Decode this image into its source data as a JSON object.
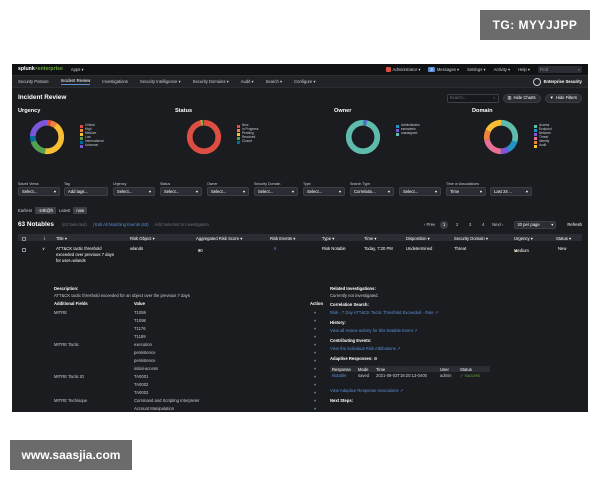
{
  "watermarks": {
    "top": "TG: MYYJJPP",
    "bottom": "www.saasjia.com"
  },
  "topbar": {
    "logo_main": "splunk",
    "logo_suffix": ">enterprise",
    "apps": "Apps ▾",
    "administrator": "Administrator ▾",
    "messages_count": "2",
    "messages": "Messages ▾",
    "settings": "Settings ▾",
    "activity": "Activity ▾",
    "help": "Help ▾",
    "find": "Find"
  },
  "nav": {
    "items": [
      "Security Posture",
      "Incident Review",
      "Investigations",
      "Security Intelligence ▾",
      "Security Domains ▾",
      "Audit ▾",
      "Search ▾",
      "Configure ▾"
    ],
    "brand": "Enterprise Security"
  },
  "header": {
    "title": "Incident Review",
    "search_placeholder": "Search...",
    "hide_charts": "Hide Charts",
    "hide_filters": "Hide Filters"
  },
  "charts": [
    {
      "title": "Urgency",
      "legend": [
        "Critical",
        "High",
        "Medium",
        "Low",
        "Informational",
        "Unknown"
      ],
      "colors": [
        "#dc4e41",
        "#f1813f",
        "#f8be34",
        "#53a051",
        "#006d9c",
        "#7b56db"
      ],
      "values": [
        4,
        6,
        42,
        18,
        6,
        24
      ]
    },
    {
      "title": "Status",
      "legend": [
        "New",
        "In Progress",
        "Pending",
        "Resolved",
        "Closed"
      ],
      "colors": [
        "#dc4e41",
        "#f1813f",
        "#f8be34",
        "#53a051",
        "#006d9c"
      ],
      "values": [
        96,
        1,
        1,
        1,
        1
      ]
    },
    {
      "title": "Owner",
      "legend": [
        "Administrator",
        "esmadmin",
        "unassigned"
      ],
      "colors": [
        "#1e93c6",
        "#7b56db",
        "#5fbcad"
      ],
      "values": [
        2,
        2,
        96
      ]
    },
    {
      "title": "Domain",
      "legend": [
        "Access",
        "Endpoint",
        "Network",
        "Threat",
        "Identity",
        "Audit"
      ],
      "colors": [
        "#5fbcad",
        "#1e93c6",
        "#7b56db",
        "#e86f96",
        "#f1813f",
        "#f8be34"
      ],
      "values": [
        30,
        12,
        8,
        22,
        10,
        18
      ]
    }
  ],
  "filters": {
    "items": [
      {
        "label": "Saved Views",
        "value": "Select..."
      },
      {
        "label": "Tag",
        "value": "Add tags..."
      },
      {
        "label": "Urgency",
        "value": "Select..."
      },
      {
        "label": "Status",
        "value": "Select..."
      },
      {
        "label": "Owner",
        "value": "Select..."
      },
      {
        "label": "Security Domain",
        "value": "Select..."
      },
      {
        "label": "Type",
        "value": "Select..."
      },
      {
        "label": "Search Type",
        "value": "Correlatio..."
      },
      {
        "label": "",
        "value": "Select..."
      },
      {
        "label": "Time or Associations",
        "value": "Time"
      },
      {
        "label": "",
        "value": "Last 24 ..."
      }
    ],
    "earliest_label": "Earliest",
    "earliest_btn": "-24h@h",
    "latest_label": "Latest",
    "latest_btn": "now"
  },
  "notables": {
    "count": "63 Notables",
    "selected": "(63 Selected)",
    "edit_selected": "| Edit All Matching Events (63)",
    "add_investigation": "Add Selected to Investigation",
    "prev": "‹ Prev",
    "pages": [
      "1",
      "2",
      "3",
      "4"
    ],
    "next": "Next ›",
    "per_page": "20 per page",
    "refresh": "Refresh"
  },
  "table": {
    "columns": [
      "i",
      "Title ▾",
      "Risk Object ▾",
      "Aggregated Risk Score ▾",
      "Risk Events ▾",
      "Type ▾",
      "Time ▾",
      "Disposition ▾",
      "Security Domain ▾",
      "Urgency ▾",
      "Status ▾"
    ],
    "row": {
      "expand": "∨",
      "title_lines": [
        "ATT&CK tactic threshold",
        "exceeded over previous 7 days",
        "for user=wlands"
      ],
      "risk_object": "wlands",
      "risk_score": "80",
      "risk_events": "6",
      "type": "Risk Notable",
      "time": "Today, 7:20 PM",
      "disposition": "Undetermined",
      "domain": "Threat",
      "urgency": "Medium",
      "status": "New"
    }
  },
  "detail": {
    "description_label": "Description:",
    "description": "ATT&CK tactic threshold exceeded for an object over the previous 7 days",
    "additional_fields": "Additional Fields",
    "value": "Value",
    "action": "Action",
    "fields": [
      {
        "name": "MITRE",
        "values": [
          "T1059",
          "T1098",
          "T1176",
          "T1189"
        ]
      },
      {
        "name": "MITRE Tactic",
        "values": [
          "execution",
          "persistence",
          "persistence",
          "initial-access"
        ]
      },
      {
        "name": "MITRE Tactic ID",
        "values": [
          "TA0001",
          "TA0002",
          "TA0003"
        ]
      },
      {
        "name": "MITRE Technique",
        "values": [
          "Command and Scripting Interpreter",
          "Account Manipulation"
        ]
      }
    ],
    "related_label": "Related Investigations:",
    "related_value": "Currently not investigated.",
    "correlation_label": "Correlation Search:",
    "correlation_value": "Risk - 7 Day ATT&CK Tactic Threshold Exceeded - Rule ↗",
    "history_label": "History:",
    "history_value": "View all review activity for this Notable Event ↗",
    "contributing_label": "Contributing Events:",
    "contributing_value": "View the individual Risk Attributions ↗",
    "adaptive_label": "Adaptive Responses:",
    "ar_columns": [
      "Response",
      "Mode",
      "Time",
      "User",
      "Status"
    ],
    "ar_row": [
      "Notable",
      "saved",
      "2021-09-03T19:20:13-0400",
      "admin",
      "✓ success"
    ],
    "ar_link": "View Adaptive Response Invocations ↗",
    "next_steps": "Next Steps:"
  }
}
